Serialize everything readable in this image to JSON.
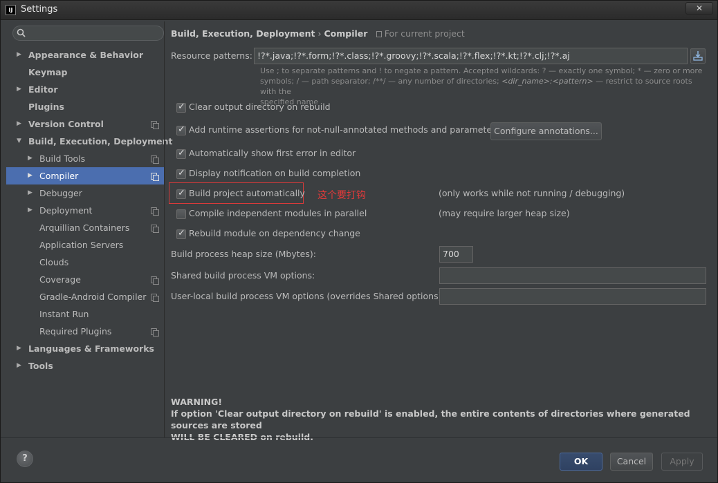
{
  "window": {
    "title": "Settings",
    "app_icon": "IJ",
    "close_glyph": "✕"
  },
  "search": {
    "placeholder": ""
  },
  "sidebar": {
    "items": [
      {
        "label": "Appearance & Behavior",
        "level": 0,
        "arrow": "▶",
        "bold": true,
        "scope": false
      },
      {
        "label": "Keymap",
        "level": 0,
        "arrow": "",
        "bold": true,
        "scope": false
      },
      {
        "label": "Editor",
        "level": 0,
        "arrow": "▶",
        "bold": true,
        "scope": false
      },
      {
        "label": "Plugins",
        "level": 0,
        "arrow": "",
        "bold": true,
        "scope": false
      },
      {
        "label": "Version Control",
        "level": 0,
        "arrow": "▶",
        "bold": true,
        "scope": true
      },
      {
        "label": "Build, Execution, Deployment",
        "level": 0,
        "arrow": "▼",
        "bold": true,
        "scope": false
      },
      {
        "label": "Build Tools",
        "level": 1,
        "arrow": "▶",
        "bold": false,
        "scope": true
      },
      {
        "label": "Compiler",
        "level": 1,
        "arrow": "▶",
        "bold": false,
        "scope": true,
        "selected": true
      },
      {
        "label": "Debugger",
        "level": 1,
        "arrow": "▶",
        "bold": false,
        "scope": false
      },
      {
        "label": "Deployment",
        "level": 1,
        "arrow": "▶",
        "bold": false,
        "scope": true
      },
      {
        "label": "Arquillian Containers",
        "level": 1,
        "arrow": "",
        "bold": false,
        "scope": true
      },
      {
        "label": "Application Servers",
        "level": 1,
        "arrow": "",
        "bold": false,
        "scope": false
      },
      {
        "label": "Clouds",
        "level": 1,
        "arrow": "",
        "bold": false,
        "scope": false
      },
      {
        "label": "Coverage",
        "level": 1,
        "arrow": "",
        "bold": false,
        "scope": true
      },
      {
        "label": "Gradle-Android Compiler",
        "level": 1,
        "arrow": "",
        "bold": false,
        "scope": true
      },
      {
        "label": "Instant Run",
        "level": 1,
        "arrow": "",
        "bold": false,
        "scope": false
      },
      {
        "label": "Required Plugins",
        "level": 1,
        "arrow": "",
        "bold": false,
        "scope": true
      },
      {
        "label": "Languages & Frameworks",
        "level": 0,
        "arrow": "▶",
        "bold": true,
        "scope": false
      },
      {
        "label": "Tools",
        "level": 0,
        "arrow": "▶",
        "bold": true,
        "scope": false
      }
    ]
  },
  "breadcrumb": {
    "parent": "Build, Execution, Deployment",
    "separator": "›",
    "current": "Compiler",
    "scope_note": "For current project"
  },
  "resource_patterns": {
    "label": "Resource patterns:",
    "value": "!?*.java;!?*.form;!?*.class;!?*.groovy;!?*.scala;!?*.flex;!?*.kt;!?*.clj;!?*.aj",
    "hint_line1": "Use ; to separate patterns and ! to negate a pattern. Accepted wildcards: ? — exactly one symbol; * — zero or more",
    "hint_line2a": "symbols; / — path separator; /**/ — any number of directories; ",
    "hint_line2b": "<dir_name>:<pattern>",
    "hint_line2c": " — restrict to source roots with the",
    "hint_line3": "specified name"
  },
  "options": {
    "clear_output": {
      "label": "Clear output directory on rebuild",
      "checked": true
    },
    "runtime_assertions": {
      "label": "Add runtime assertions for not-null-annotated methods and parameters",
      "checked": true
    },
    "configure_button": "Configure annotations...",
    "show_first_error": {
      "label": "Automatically show first error in editor",
      "checked": true
    },
    "notify_completion": {
      "label": "Display notification on build completion",
      "checked": true
    },
    "build_auto": {
      "label": "Build project automatically",
      "checked": true,
      "note": "(only works while not running / debugging)"
    },
    "compile_parallel": {
      "label": "Compile independent modules in parallel",
      "checked": false,
      "note": "(may require larger heap size)"
    },
    "rebuild_module": {
      "label": "Rebuild module on dependency change",
      "checked": true
    }
  },
  "annotation_text": "这个要打钩",
  "heap": {
    "label": "Build process heap size (Mbytes):",
    "value": "700"
  },
  "shared_vm": {
    "label": "Shared build process VM options:",
    "value": ""
  },
  "user_vm": {
    "label": "User-local build process VM options (overrides Shared options):",
    "value": ""
  },
  "warning": {
    "title": "WARNING!",
    "line1": "If option 'Clear output directory on rebuild' is enabled, the entire contents of directories where generated sources are stored",
    "line2": "WILL BE CLEARED on rebuild."
  },
  "footer": {
    "ok": "OK",
    "cancel": "Cancel",
    "apply": "Apply",
    "help": "?"
  },
  "colors": {
    "selection": "#4b6eaf",
    "annotation_red": "#e23a3a",
    "panel_bg": "#3c3f41"
  }
}
